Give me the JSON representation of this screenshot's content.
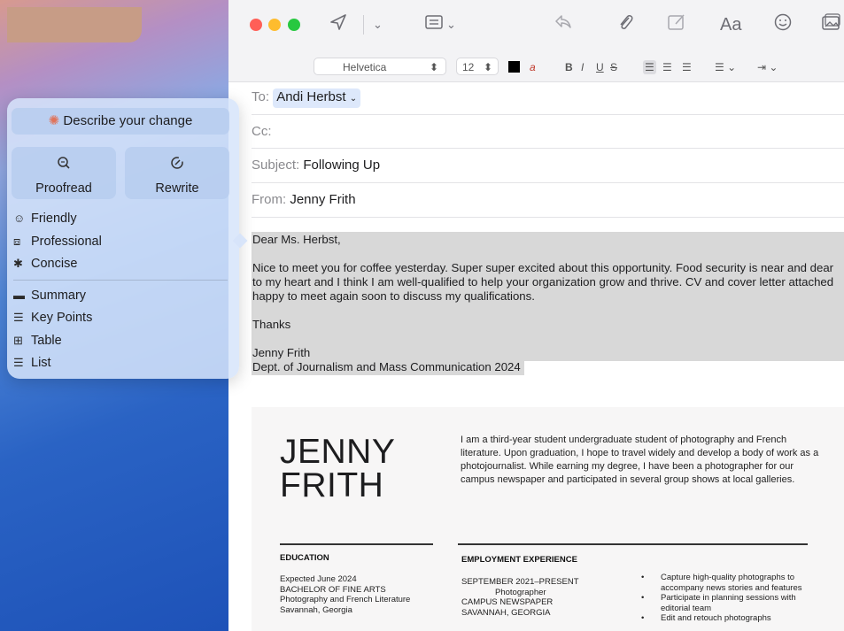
{
  "window": {
    "traffic_lights": {
      "close": "#ff5f57",
      "minimize": "#febc2e",
      "zoom": "#28c840"
    },
    "toolbar_icons": [
      "send-icon",
      "chevron-down-icon",
      "header-fields-icon",
      "chevron-down-icon",
      "reply-icon",
      "attachment-icon",
      "markup-icon",
      "font-panel-icon",
      "emoji-icon",
      "photo-browser-icon"
    ],
    "font_button_label": "Aa"
  },
  "format_bar": {
    "font": "Helvetica",
    "size": "12",
    "text_color": "#000000",
    "bold": "B",
    "italic": "I",
    "underline": "U",
    "strike": "S"
  },
  "headers": {
    "to_label": "To:",
    "to_value": "Andi Herbst",
    "cc_label": "Cc:",
    "subject_label": "Subject:",
    "subject_value": "Following Up",
    "from_label": "From:",
    "from_value": "Jenny Frith"
  },
  "email_body": {
    "greeting": "Dear Ms. Herbst,",
    "para1_line1": "Nice to meet you for coffee yesterday. Super super excited about this opportunity. Food security is near and dear",
    "para1_line2": "to my heart and I think I am well-qualified to help your organization grow and thrive. CV and cover letter attached",
    "para1_line3": "happy to meet again soon to discuss my qualifications.",
    "thanks": "Thanks",
    "sig_name": "Jenny Frith",
    "sig_dept": "Dept. of Journalism and Mass Communication 2024"
  },
  "resume": {
    "name_line1": "JENNY",
    "name_line2": "FRITH",
    "bio": "I am a third-year student undergraduate student of photography and French literature. Upon graduation, I hope to travel widely and develop a body of work as a photojournalist. While earning my degree, I have been a photographer for our campus newspaper and participated in several group shows at local galleries.",
    "education_heading": "EDUCATION",
    "education_lines": [
      "Expected June 2024",
      "BACHELOR OF FINE ARTS",
      "Photography and French Literature",
      "Savannah, Georgia"
    ],
    "employment_heading": "EMPLOYMENT EXPERIENCE",
    "employment_lines": [
      "SEPTEMBER 2021–PRESENT",
      "Photographer",
      "CAMPUS NEWSPAPER",
      "SAVANNAH, GEORGIA"
    ],
    "bullets": [
      "Capture high-quality photographs to accompany news stories and features",
      "Participate in planning sessions with editorial team",
      "Edit and retouch photographs"
    ]
  },
  "writing_tools": {
    "describe_label": "Describe your change",
    "proofread_label": "Proofread",
    "rewrite_label": "Rewrite",
    "tone_items": [
      {
        "icon": "smile-icon",
        "label": "Friendly"
      },
      {
        "icon": "briefcase-icon",
        "label": "Professional"
      },
      {
        "icon": "concise-icon",
        "label": "Concise"
      }
    ],
    "format_items": [
      {
        "icon": "summary-icon",
        "label": "Summary"
      },
      {
        "icon": "key-points-icon",
        "label": "Key Points"
      },
      {
        "icon": "table-icon",
        "label": "Table"
      },
      {
        "icon": "list-icon",
        "label": "List"
      }
    ]
  }
}
